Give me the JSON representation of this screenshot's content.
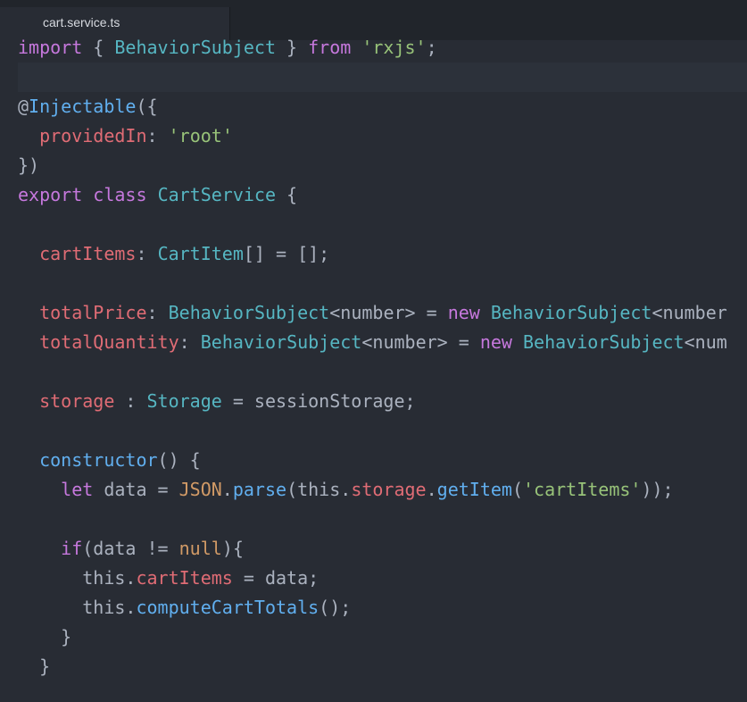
{
  "tab": {
    "filename": "cart.service.ts"
  },
  "code": [
    [
      [
        "kw",
        "import"
      ],
      [
        "pl",
        " { "
      ],
      [
        "ty",
        "BehaviorSubject"
      ],
      [
        "pl",
        " } "
      ],
      [
        "kw",
        "from"
      ],
      [
        "pl",
        " "
      ],
      [
        "str",
        "'rxjs'"
      ],
      [
        "pl",
        ";"
      ]
    ],
    [],
    [
      [
        "pl",
        "@"
      ],
      [
        "fn",
        "Injectable"
      ],
      [
        "pl",
        "({"
      ]
    ],
    [
      [
        "pl",
        "  "
      ],
      [
        "prop",
        "providedIn"
      ],
      [
        "pl",
        ": "
      ],
      [
        "str",
        "'root'"
      ]
    ],
    [
      [
        "pl",
        "})"
      ]
    ],
    [
      [
        "kw",
        "export"
      ],
      [
        "pl",
        " "
      ],
      [
        "kw",
        "class"
      ],
      [
        "pl",
        " "
      ],
      [
        "ty",
        "CartService"
      ],
      [
        "pl",
        " {"
      ]
    ],
    [],
    [
      [
        "pl",
        "  "
      ],
      [
        "prop",
        "cartItems"
      ],
      [
        "pl",
        ": "
      ],
      [
        "ty",
        "CartItem"
      ],
      [
        "pl",
        "[] = [];"
      ]
    ],
    [],
    [
      [
        "pl",
        "  "
      ],
      [
        "prop",
        "totalPrice"
      ],
      [
        "pl",
        ": "
      ],
      [
        "ty",
        "BehaviorSubject"
      ],
      [
        "pl",
        "<number> = "
      ],
      [
        "kw",
        "new"
      ],
      [
        "pl",
        " "
      ],
      [
        "ty",
        "BehaviorSubject"
      ],
      [
        "pl",
        "<number"
      ]
    ],
    [
      [
        "pl",
        "  "
      ],
      [
        "prop",
        "totalQuantity"
      ],
      [
        "pl",
        ": "
      ],
      [
        "ty",
        "BehaviorSubject"
      ],
      [
        "pl",
        "<number> = "
      ],
      [
        "kw",
        "new"
      ],
      [
        "pl",
        " "
      ],
      [
        "ty",
        "BehaviorSubject"
      ],
      [
        "pl",
        "<num"
      ]
    ],
    [],
    [
      [
        "pl",
        "  "
      ],
      [
        "prop",
        "storage"
      ],
      [
        "pl",
        " : "
      ],
      [
        "ty",
        "Storage"
      ],
      [
        "pl",
        " = sessionStorage;"
      ]
    ],
    [],
    [
      [
        "pl",
        "  "
      ],
      [
        "fn",
        "constructor"
      ],
      [
        "pl",
        "() {"
      ]
    ],
    [
      [
        "pl",
        "    "
      ],
      [
        "kw",
        "let"
      ],
      [
        "pl",
        " data = "
      ],
      [
        "num",
        "JSON"
      ],
      [
        "pl",
        "."
      ],
      [
        "fn",
        "parse"
      ],
      [
        "pl",
        "(this."
      ],
      [
        "prop",
        "storage"
      ],
      [
        "pl",
        "."
      ],
      [
        "fn",
        "getItem"
      ],
      [
        "pl",
        "("
      ],
      [
        "str",
        "'cartItems'"
      ],
      [
        "pl",
        "));"
      ]
    ],
    [],
    [
      [
        "pl",
        "    "
      ],
      [
        "kw",
        "if"
      ],
      [
        "pl",
        "(data != "
      ],
      [
        "num",
        "null"
      ],
      [
        "pl",
        "){"
      ]
    ],
    [
      [
        "pl",
        "      this."
      ],
      [
        "prop",
        "cartItems"
      ],
      [
        "pl",
        " = data;"
      ]
    ],
    [
      [
        "pl",
        "      this."
      ],
      [
        "fn",
        "computeCartTotals"
      ],
      [
        "pl",
        "();"
      ]
    ],
    [
      [
        "pl",
        "    }"
      ]
    ],
    [
      [
        "pl",
        "  }"
      ]
    ]
  ]
}
